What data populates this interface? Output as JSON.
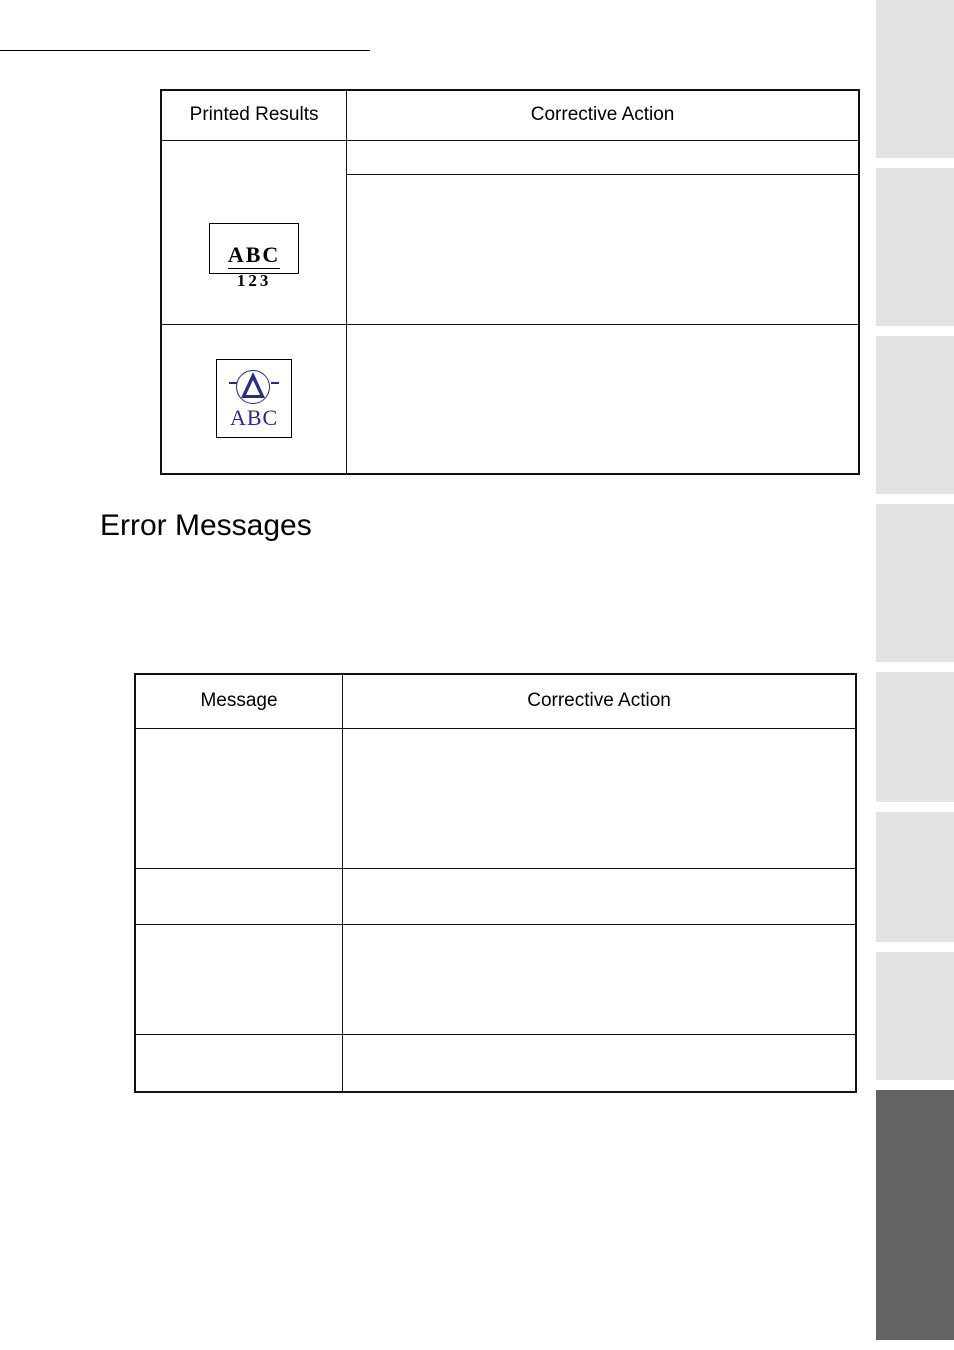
{
  "table1": {
    "headers": {
      "col1": "Printed Results",
      "col2": "Corrective Action"
    },
    "row2": {
      "label_top": "ABC",
      "label_bottom": "123",
      "action_a": "",
      "action_b": ""
    },
    "row3": {
      "label_abc": "ABC",
      "action": ""
    }
  },
  "section_heading": "Error Messages",
  "table2": {
    "headers": {
      "col1": "Message",
      "col2": "Corrective Action"
    },
    "rows": [
      {
        "msg": "",
        "action": ""
      },
      {
        "msg": "",
        "action": ""
      },
      {
        "msg": "",
        "action": ""
      },
      {
        "msg": "",
        "action": ""
      }
    ]
  }
}
